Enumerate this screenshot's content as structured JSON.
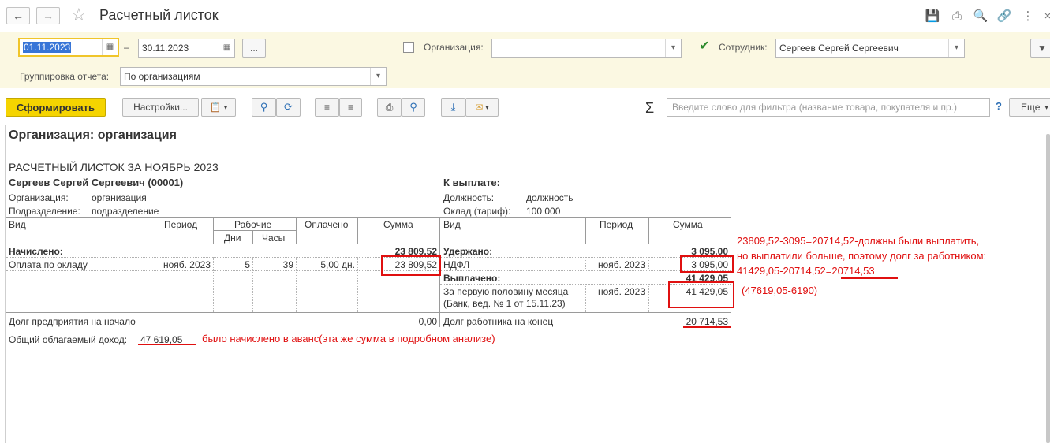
{
  "window": {
    "title": "Расчетный листок"
  },
  "params": {
    "date_from": "01.11.2023",
    "date_sep": "–",
    "date_to": "30.11.2023",
    "more_label": "...",
    "org_label": "Организация:",
    "org_value": "",
    "emp_label": "Сотрудник:",
    "emp_value": "Сергеев Сергей Сергеевич",
    "group_label": "Группировка отчета:",
    "group_value": "По организациям"
  },
  "toolbar": {
    "generate_label": "Сформировать",
    "settings_label": "Настройки...",
    "search_placeholder": "Введите слово для фильтра (название товара, покупателя и пр.)",
    "help_label": "?",
    "more_label": "Еще"
  },
  "report": {
    "org_header": "Организация: организация",
    "title": "РАСЧЕТНЫЙ ЛИСТОК ЗА НОЯБРЬ 2023",
    "employee": "Сергеев Сергей Сергеевич (00001)",
    "org_label": "Организация:",
    "org_value": "организация",
    "dept_label": "Подразделение:",
    "dept_value": "подразделение",
    "to_pay_label": "К выплате:",
    "position_label": "Должность:",
    "position_value": "должность",
    "salary_label": "Оклад (тариф):",
    "salary_value": "100 000",
    "left_headers": {
      "kind": "Вид",
      "period": "Период",
      "working": "Рабочие",
      "days": "Дни",
      "hours": "Часы",
      "paid": "Оплачено",
      "amount": "Сумма"
    },
    "right_headers": {
      "kind": "Вид",
      "period": "Период",
      "amount": "Сумма"
    },
    "accrued_label": "Начислено:",
    "accrued_total": "23 809,52",
    "accrual_row": {
      "kind": "Оплата по окладу",
      "period": "нояб. 2023",
      "days": "5",
      "hours": "39",
      "paid": "5,00 дн.",
      "amount": "23 809,52"
    },
    "withheld_label": "Удержано:",
    "withheld_total": "3 095,00",
    "ndfl_row": {
      "kind": "НДФЛ",
      "period": "нояб. 2023",
      "amount": "3 095,00"
    },
    "paid_label": "Выплачено:",
    "paid_total": "41 429,05",
    "payment_row": {
      "kind_line1": "За первую половину месяца",
      "kind_line2": "(Банк, вед. № 1 от 15.11.23)",
      "period": "нояб. 2023",
      "amount": "41 429,05"
    },
    "debt_start_label": "Долг предприятия на начало",
    "debt_start_value": "0,00",
    "debt_end_label": "Долг работника на конец",
    "debt_end_value": "20 714,53",
    "taxable_label": "Общий облагаемый доход:",
    "taxable_value": "47 619,05"
  },
  "annotations": {
    "note1_line1": "23809,52-3095=20714,52-должны были выплатить,",
    "note1_line2": "но выплатили больше, поэтому долг за работником:",
    "note1_line3": "41429,05-20714,52=20714,53",
    "note2": "(47619,05-6190)",
    "note3": "было начислено в аванс(эта же сумма в подробном анализе)"
  },
  "colors": {
    "accent_yellow": "#f5d400",
    "params_bg": "#fbf8e2",
    "annotation_red": "#e01010",
    "check_green": "#2c8a2c"
  }
}
